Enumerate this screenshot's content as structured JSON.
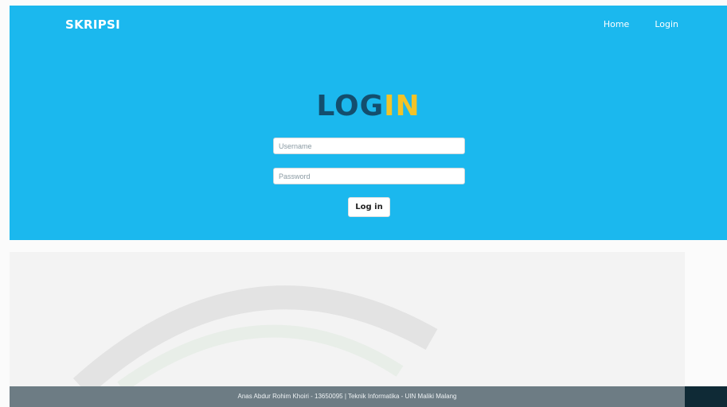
{
  "navbar": {
    "brand": "SKRIPSI",
    "links": [
      "Home",
      "Login"
    ]
  },
  "login_form": {
    "title_part1": "LOG",
    "title_part2": "IN",
    "username_placeholder": "Username",
    "password_placeholder": "Password",
    "submit_label": "Log in"
  },
  "footer": {
    "text": "Anas Abdur Rohim Khoiri - 13650095 | Teknik Informatika - UIN Maliki Malang"
  },
  "colors": {
    "hero_background": "#1bb8ee",
    "title_dark": "#134e6e",
    "title_accent": "#f3c327",
    "footer_background": "#6d7c84"
  }
}
